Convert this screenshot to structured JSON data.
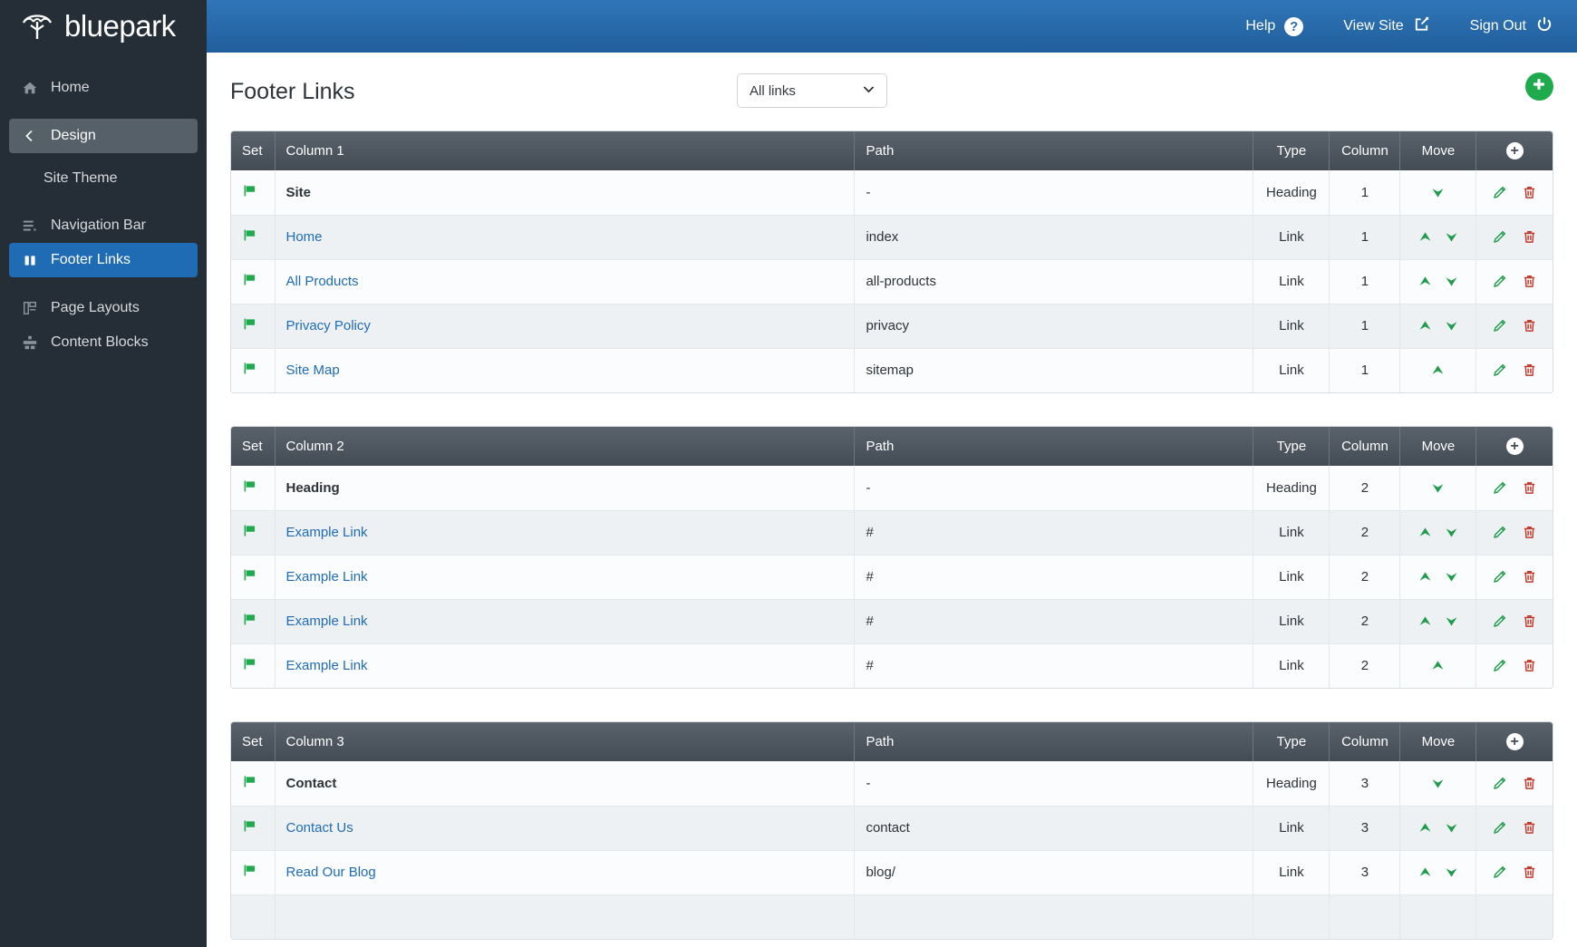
{
  "brand": {
    "name": "bluepark",
    "logo_icon": "tree-logo-icon"
  },
  "topbar": {
    "help_label": "Help",
    "help_icon": "question-circle-icon",
    "view_site_label": "View Site",
    "view_site_icon": "external-link-icon",
    "sign_out_label": "Sign Out",
    "sign_out_icon": "power-icon"
  },
  "sidebar": {
    "items": [
      {
        "label": "Home",
        "icon": "home-icon",
        "state": "normal"
      },
      {
        "label": "Design",
        "icon": "chevron-left-icon",
        "state": "active-group"
      },
      {
        "label": "Site Theme",
        "icon": "",
        "state": "sub"
      },
      {
        "label": "Navigation Bar",
        "icon": "list-icon",
        "state": "normal"
      },
      {
        "label": "Footer Links",
        "icon": "columns-icon",
        "state": "active"
      },
      {
        "label": "Page Layouts",
        "icon": "layout-icon",
        "state": "normal"
      },
      {
        "label": "Content Blocks",
        "icon": "blocks-icon",
        "state": "normal"
      }
    ]
  },
  "page": {
    "title": "Footer Links",
    "filter_value": "All links",
    "filter_icon": "chevron-down-icon",
    "add_button_icon": "plus-icon"
  },
  "table_columns": {
    "set": "Set",
    "path": "Path",
    "type": "Type",
    "column": "Column",
    "move": "Move",
    "add_icon": "plus-circle-icon"
  },
  "row_icons": {
    "flag": "flag-icon",
    "move_up": "arrow-up-icon",
    "move_down": "arrow-down-icon",
    "edit": "pencil-icon",
    "delete": "trash-icon"
  },
  "colors": {
    "sidebar_bg": "#252d36",
    "accent_blue": "#1f6cb5",
    "header_blue": "#2f76b8",
    "table_header": "#4a535c",
    "green": "#1faa4e",
    "link_blue": "#1f6cb5",
    "red": "#c0392b"
  },
  "tables": [
    {
      "name_header": "Column 1",
      "rows": [
        {
          "name": "Site",
          "path": "-",
          "type": "Heading",
          "column": "1",
          "is_link": false,
          "up": false,
          "down": true
        },
        {
          "name": "Home",
          "path": "index",
          "type": "Link",
          "column": "1",
          "is_link": true,
          "up": true,
          "down": true
        },
        {
          "name": "All Products",
          "path": "all-products",
          "type": "Link",
          "column": "1",
          "is_link": true,
          "up": true,
          "down": true
        },
        {
          "name": "Privacy Policy",
          "path": "privacy",
          "type": "Link",
          "column": "1",
          "is_link": true,
          "up": true,
          "down": true
        },
        {
          "name": "Site Map",
          "path": "sitemap",
          "type": "Link",
          "column": "1",
          "is_link": true,
          "up": true,
          "down": false
        }
      ]
    },
    {
      "name_header": "Column 2",
      "rows": [
        {
          "name": "Heading",
          "path": "-",
          "type": "Heading",
          "column": "2",
          "is_link": false,
          "up": false,
          "down": true
        },
        {
          "name": "Example Link",
          "path": "#",
          "type": "Link",
          "column": "2",
          "is_link": true,
          "up": true,
          "down": true
        },
        {
          "name": "Example Link",
          "path": "#",
          "type": "Link",
          "column": "2",
          "is_link": true,
          "up": true,
          "down": true
        },
        {
          "name": "Example Link",
          "path": "#",
          "type": "Link",
          "column": "2",
          "is_link": true,
          "up": true,
          "down": true
        },
        {
          "name": "Example Link",
          "path": "#",
          "type": "Link",
          "column": "2",
          "is_link": true,
          "up": true,
          "down": false
        }
      ]
    },
    {
      "name_header": "Column 3",
      "rows": [
        {
          "name": "Contact",
          "path": "-",
          "type": "Heading",
          "column": "3",
          "is_link": false,
          "up": false,
          "down": true
        },
        {
          "name": "Contact Us",
          "path": "contact",
          "type": "Link",
          "column": "3",
          "is_link": true,
          "up": true,
          "down": true
        },
        {
          "name": "Read Our Blog",
          "path": "blog/",
          "type": "Link",
          "column": "3",
          "is_link": true,
          "up": true,
          "down": true
        },
        {
          "name": "",
          "path": "",
          "type": "",
          "column": "",
          "is_link": false,
          "up": false,
          "down": false
        }
      ]
    }
  ]
}
